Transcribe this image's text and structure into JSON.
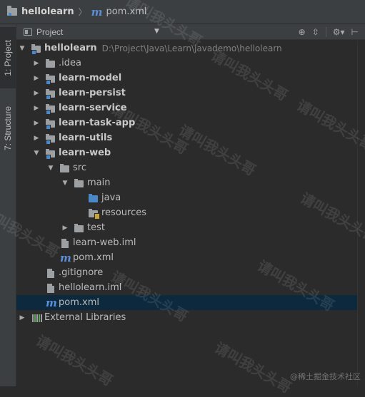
{
  "breadcrumb": {
    "project": "hellolearn",
    "file": "pom.xml"
  },
  "left_strip": {
    "project_tab": "1: Project",
    "structure_tab": "7: Structure"
  },
  "panel": {
    "view_label": "Project"
  },
  "tree": {
    "root": {
      "label": "hellolearn",
      "path": "D:\\Project\\Java\\Learn\\javademo\\hellolearn"
    },
    "idea": ".idea",
    "learn_model": "learn-model",
    "learn_persist": "learn-persist",
    "learn_service": "learn-service",
    "learn_task_app": "learn-task-app",
    "learn_utils": "learn-utils",
    "learn_web": "learn-web",
    "src": "src",
    "main": "main",
    "java": "java",
    "resources": "resources",
    "test": "test",
    "learn_web_iml": "learn-web.iml",
    "web_pom": "pom.xml",
    "gitignore": ".gitignore",
    "hellolearn_iml": "hellolearn.iml",
    "root_pom": "pom.xml",
    "external_libraries": "External Libraries"
  },
  "watermark": {
    "text": "请叫我头头哥",
    "credit": "@稀土掘金技术社区"
  },
  "colors": {
    "background": "#2b2b2b",
    "panel": "#3c3f41",
    "selection": "#0d293e",
    "folder_blue": "#4a88c7",
    "maven_blue": "#5a8fd8"
  }
}
